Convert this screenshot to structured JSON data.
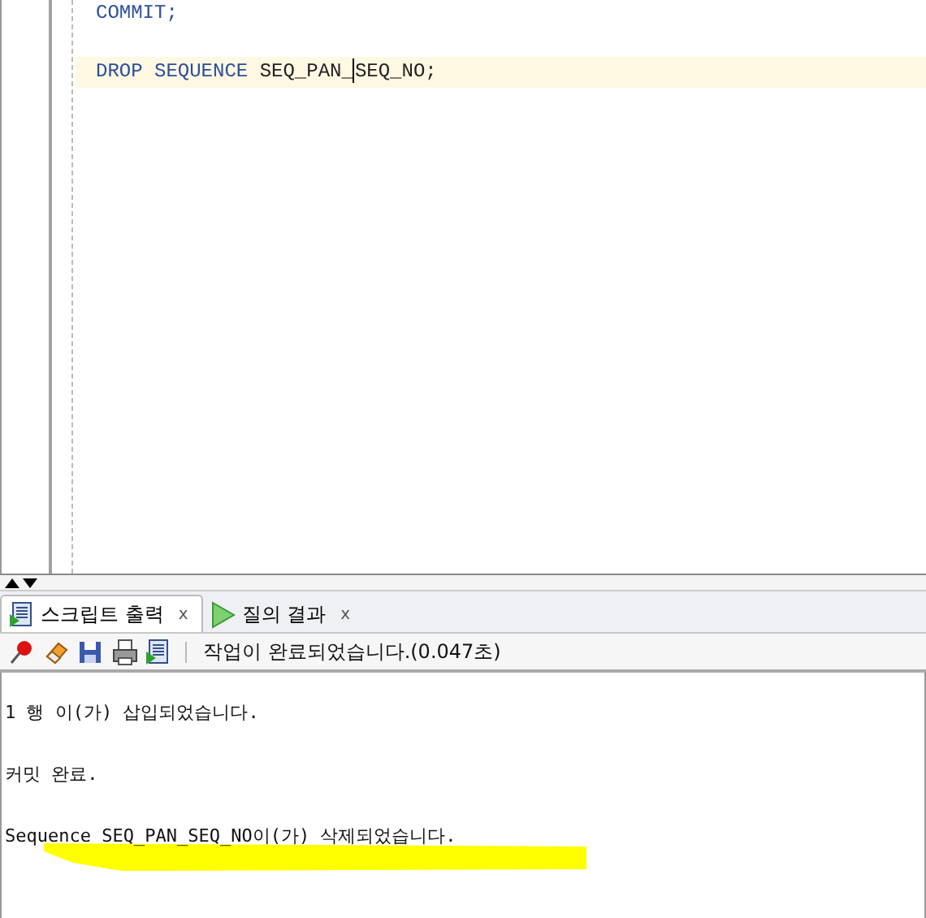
{
  "editor": {
    "lines": [
      {
        "kind": "code",
        "current": false,
        "tokens": [
          {
            "kind": "keyword",
            "text": "COMMIT;"
          }
        ]
      },
      {
        "kind": "blank",
        "current": false
      },
      {
        "kind": "code",
        "current": true,
        "tokens": [
          {
            "kind": "keyword",
            "text": "DROP SEQUENCE"
          },
          {
            "kind": "identifier",
            "text": " SEQ_PAN_"
          },
          {
            "kind": "cursor"
          },
          {
            "kind": "identifier",
            "text": "SEQ_NO;"
          }
        ]
      }
    ]
  },
  "tabs": [
    {
      "label": "스크립트 출력",
      "selected": true,
      "close": "x"
    },
    {
      "label": "질의 결과",
      "selected": false,
      "close": "x"
    }
  ],
  "toolbar": {
    "status": "작업이 완료되었습니다.(0.047초)"
  },
  "output": {
    "lines": [
      "1 행 이(가) 삽입되었습니다.",
      "커밋 완료.",
      "Sequence SEQ_PAN_SEQ_NO이(가) 삭제되었습니다."
    ]
  }
}
